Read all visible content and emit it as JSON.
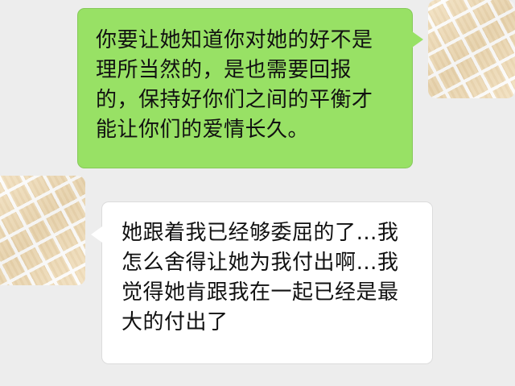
{
  "messages": [
    {
      "sender": "self",
      "text": "你要让她知道你对她的好不是\n理所当然的，是也需要回报\n的，保持好你们之间的平衡才\n能让你们的爱情长久。",
      "bubble_color": "#98e165"
    },
    {
      "sender": "friend",
      "text": "她跟着我已经够委屈的了…我\n怎么舍得让她为我付出啊…我\n觉得她肯跟我在一起已经是最\n大的付出了",
      "bubble_color": "#ffffff"
    }
  ],
  "avatars": {
    "self": "checkered-beige-avatar",
    "friend": "checkered-beige-avatar"
  },
  "background_color": "#ededed"
}
